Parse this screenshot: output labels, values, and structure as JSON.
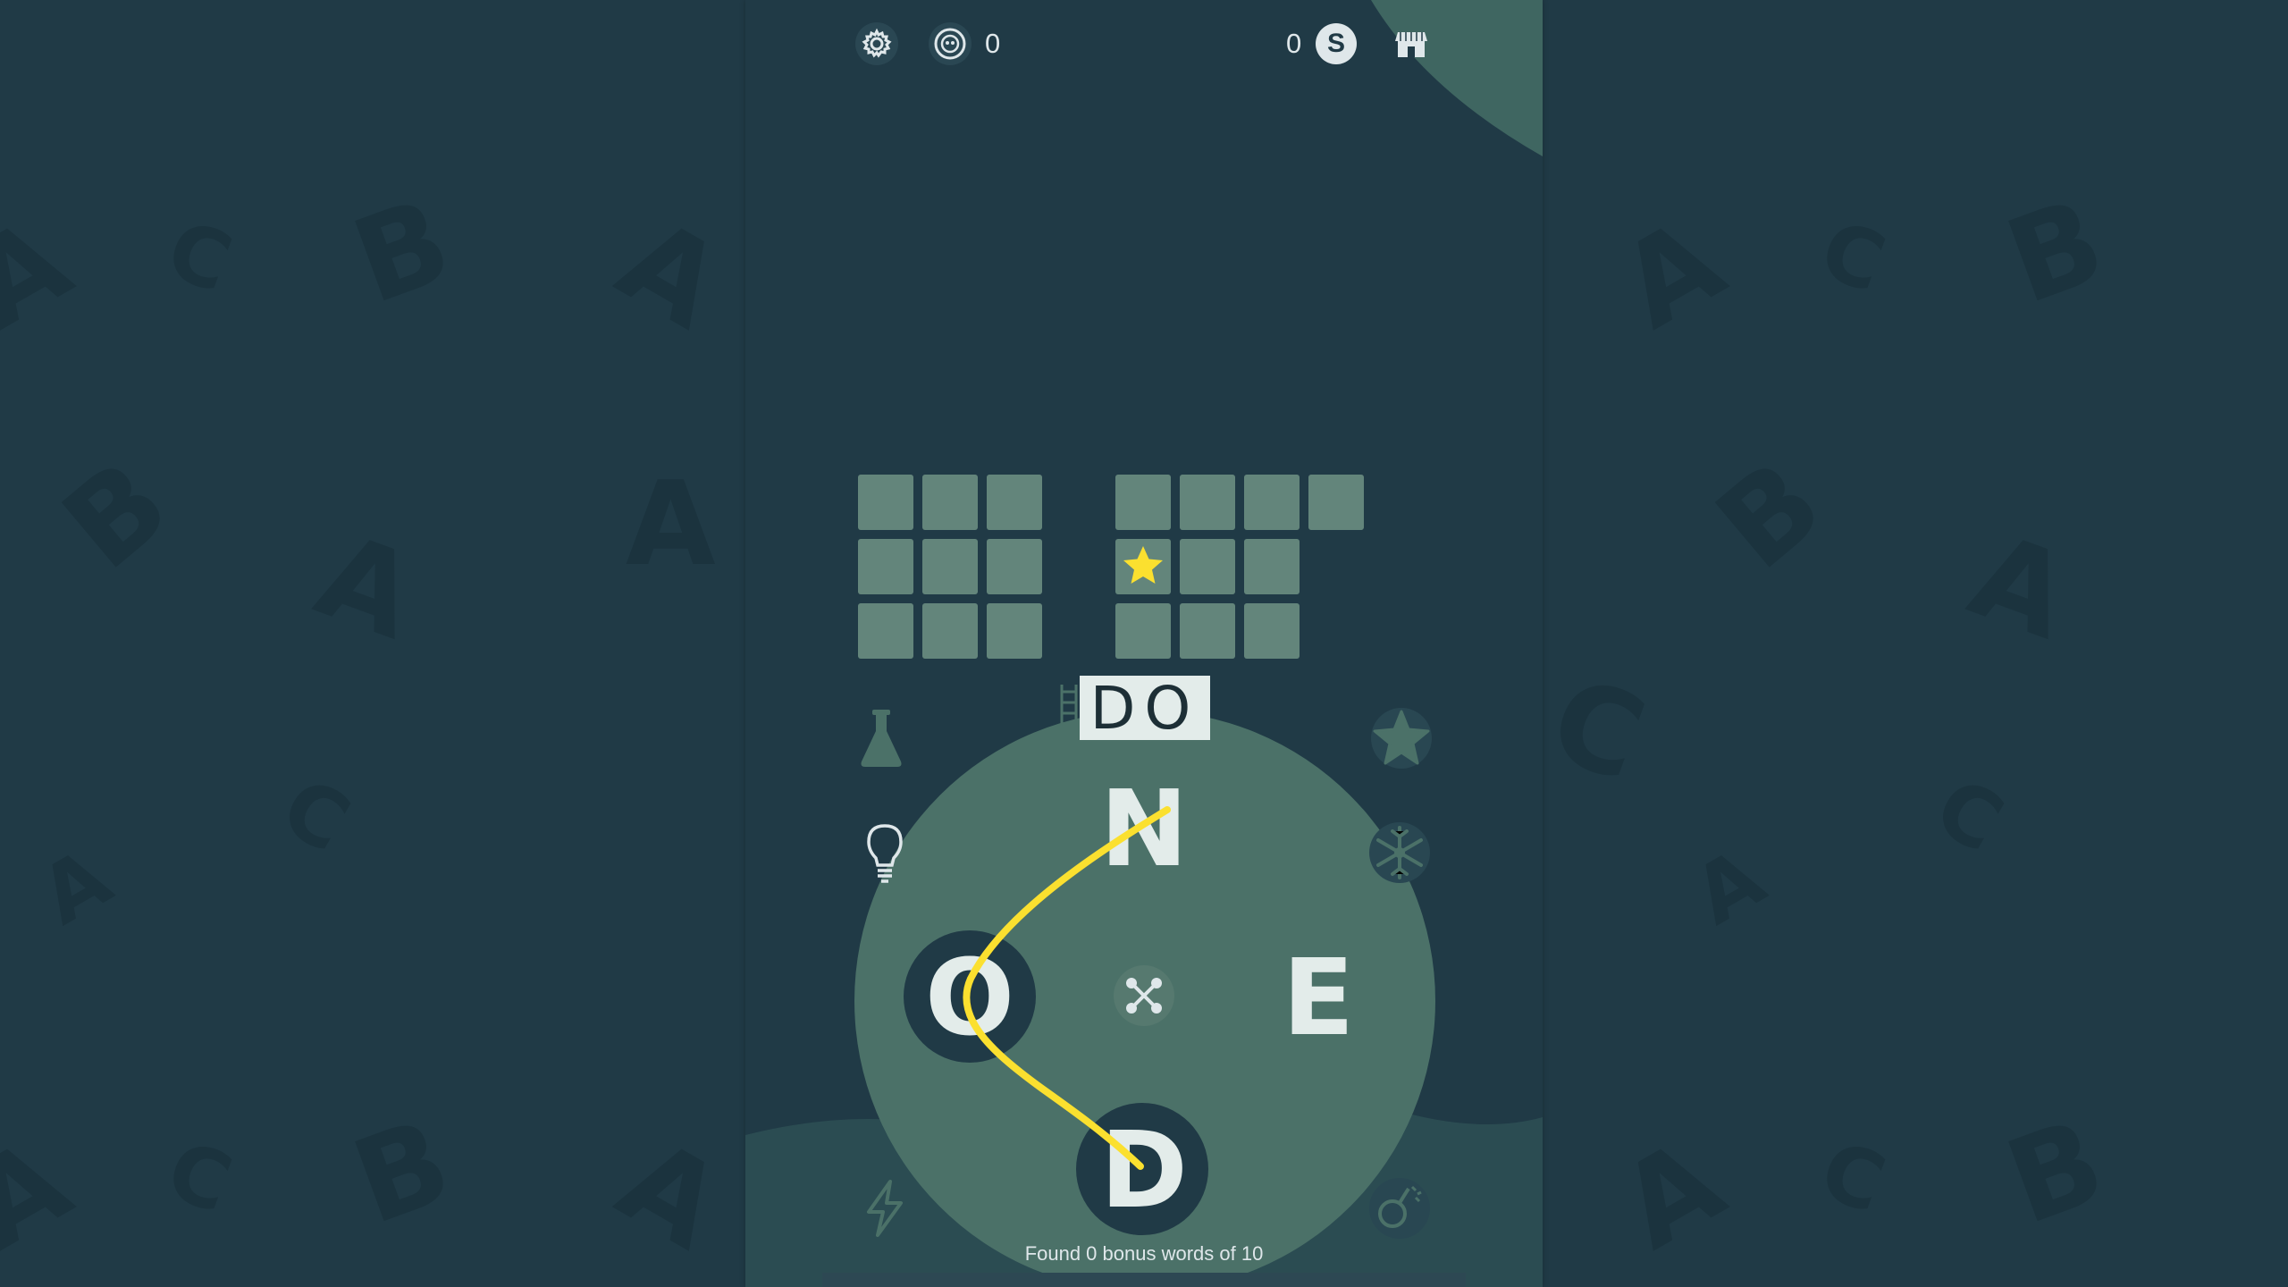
{
  "topbar": {
    "hint_count": "0",
    "coin_count": "0",
    "coin_symbol": "S"
  },
  "grid": {
    "left_word": {
      "rows": 3,
      "cols": 3
    },
    "right_word_rows": [
      4,
      3,
      3
    ],
    "star_cell": "right-row2-col1"
  },
  "preview": {
    "text": "DO"
  },
  "wheel": {
    "letters": [
      "N",
      "O",
      "E",
      "D"
    ],
    "selected": [
      "D",
      "O"
    ]
  },
  "footer": {
    "bonus_text": "Found 0 bonus words of 10"
  },
  "colors": {
    "background": "#203a46",
    "tile": "#63857b",
    "wheel": "#4b7168",
    "path": "#fbe02f",
    "star": "#fbe02f"
  },
  "icons": [
    "gear-icon",
    "hint-coin-icon",
    "coin-icon",
    "shop-icon",
    "flask-icon",
    "star-icon",
    "lightbulb-icon",
    "snowflake-icon",
    "shuffle-icon",
    "lightning-icon",
    "bomb-icon"
  ]
}
